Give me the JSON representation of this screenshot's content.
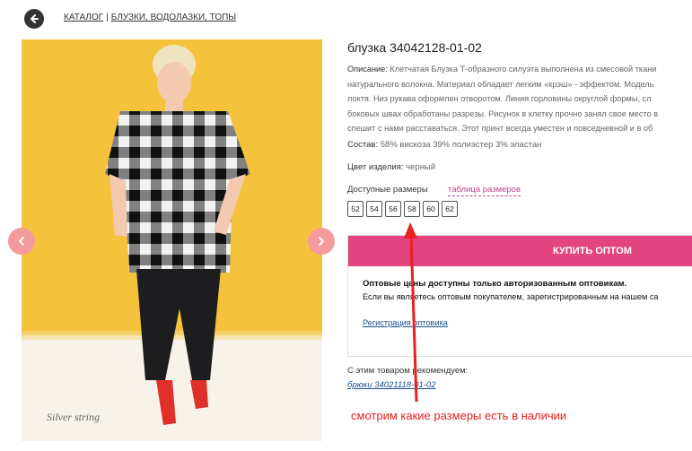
{
  "breadcrumb": {
    "catalog": "КАТАЛОГ",
    "separator": "|",
    "category": "БЛУЗКИ, ВОДОЛАЗКИ, ТОПЫ"
  },
  "product": {
    "title": "блузка 34042128-01-02",
    "description_label": "Описание:",
    "description_lines": [
      "Клетчатая Блузка Т-образного силуэта выполнена из смесовой ткани",
      "натурального волокна. Материал обладает легким «крэш» - эффектом. Модель",
      "локтя. Низ рукава оформлен отворотом. Линия горловины округлой формы, сл",
      "боковых швах обработаны разрезы. Рисунок в клетку прочно занял свое место в",
      "спешит с нами расставаться. Этот принт всегда уместен и повседневной и в об"
    ],
    "composition_label": "Состав:",
    "composition_value": "58% вискоза 39% полиэстер 3% эластан",
    "color_label": "Цвет изделия:",
    "color_value": "черный"
  },
  "sizes": {
    "label": "Доступные размеры",
    "table_link": "таблица размеров",
    "items": [
      "52",
      "54",
      "56",
      "58",
      "60",
      "62"
    ]
  },
  "buy": {
    "button_label": "КУПИТЬ ОПТОМ",
    "wholesale_title": "Оптовые цены доступны только авторизованным оптовикам.",
    "wholesale_text": "Если вы являетесь оптовым покупателем, зарегистрированным на нашем са",
    "register_link": "Регистрация оптовика"
  },
  "recommend": {
    "label": "С этим товаром рекомендуем:",
    "link": "брюки 34021118-01-02"
  },
  "photo": {
    "watermark": "Silver string"
  },
  "annotation": {
    "text": "смотрим какие размеры есть в наличии"
  },
  "colors": {
    "accent": "#e2457f",
    "link": "#1a4f8a",
    "size_link": "#c0478c",
    "annotation": "#e8201e",
    "photo_bg": "#f5c33b",
    "nav_arrow": "#f49a9c"
  },
  "icons": {
    "back": "arrow-left-circle-icon",
    "prev": "chevron-left-icon",
    "next": "chevron-right-icon"
  }
}
